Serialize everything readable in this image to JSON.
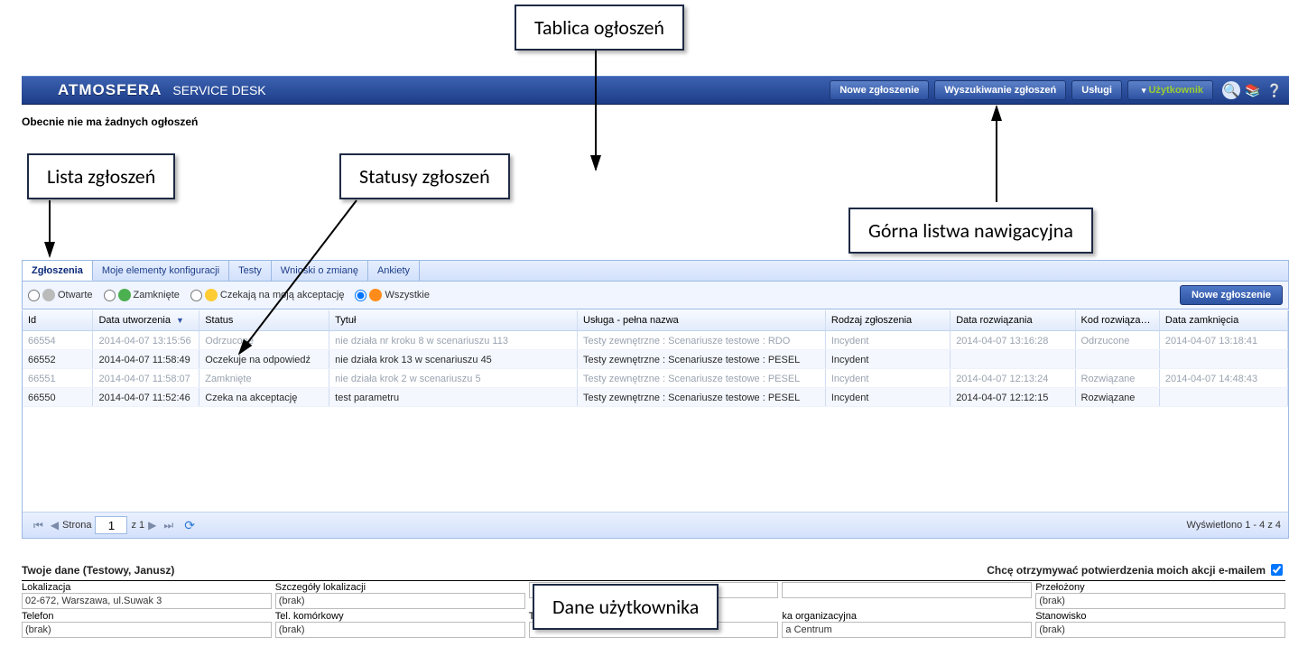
{
  "callouts": {
    "announcements": "Tablica ogłoszeń",
    "ticket_list": "Lista zgłoszeń",
    "statuses": "Statusy zgłoszeń",
    "top_nav": "Górna listwa nawigacyjna",
    "user_data": "Dane użytkownika"
  },
  "topbar": {
    "logo": "ATMOSFERA",
    "app": "SERVICE DESK",
    "buttons": {
      "new": "Nowe zgłoszenie",
      "search": "Wyszukiwanie zgłoszeń",
      "services": "Usługi",
      "user": "Użytkownik"
    }
  },
  "announce": "Obecnie nie ma żadnych ogłoszeń",
  "tabs": [
    "Zgłoszenia",
    "Moje elementy konfiguracji",
    "Testy",
    "Wnioski o zmianę",
    "Ankiety"
  ],
  "filters": {
    "open": "Otwarte",
    "closed": "Zamknięte",
    "awaiting": "Czekają na moją akceptację",
    "all": "Wszystkie",
    "primary": "Nowe zgłoszenie"
  },
  "columns": {
    "id": "Id",
    "created": "Data utworzenia",
    "status": "Status",
    "title": "Tytuł",
    "service": "Usługa - pełna nazwa",
    "kind": "Rodzaj zgłoszenia",
    "resolved": "Data rozwiązania",
    "rescode": "Kod rozwiązania",
    "closed": "Data zamknięcia"
  },
  "rows": [
    {
      "faded": true,
      "id": "66554",
      "created": "2014-04-07 13:15:56",
      "status": "Odrzucone",
      "title": "nie działa nr kroku 8 w scenariuszu 113",
      "service": "Testy zewnętrzne : Scenariusze testowe : RDO",
      "kind": "Incydent",
      "resolved": "2014-04-07 13:16:28",
      "rescode": "Odrzucone",
      "closed": "2014-04-07 13:18:41"
    },
    {
      "faded": false,
      "id": "66552",
      "created": "2014-04-07 11:58:49",
      "status": "Oczekuje na odpowiedź",
      "title": "nie działa krok 13 w scenariuszu 45",
      "service": "Testy zewnętrzne : Scenariusze testowe : PESEL",
      "kind": "Incydent",
      "resolved": "",
      "rescode": "",
      "closed": ""
    },
    {
      "faded": true,
      "id": "66551",
      "created": "2014-04-07 11:58:07",
      "status": "Zamknięte",
      "title": "nie działa krok 2 w scenariuszu 5",
      "service": "Testy zewnętrzne : Scenariusze testowe : PESEL",
      "kind": "Incydent",
      "resolved": "2014-04-07 12:13:24",
      "rescode": "Rozwiązane",
      "closed": "2014-04-07 14:48:43"
    },
    {
      "faded": false,
      "id": "66550",
      "created": "2014-04-07 11:52:46",
      "status": "Czeka na akceptację",
      "title": "test parametru",
      "service": "Testy zewnętrzne : Scenariusze testowe : PESEL",
      "kind": "Incydent",
      "resolved": "2014-04-07 12:12:15",
      "rescode": "Rozwiązane",
      "closed": ""
    }
  ],
  "pager": {
    "page_label": "Strona",
    "page": "1",
    "of": "z 1",
    "summary": "Wyświetlono 1 - 4 z 4"
  },
  "userpanel": {
    "title": "Twoje dane (Testowy, Janusz)",
    "opt_label": "Chcę otrzymywać potwierdzenia moich akcji e-mailem",
    "fields": {
      "loc_label": "Lokalizacja",
      "loc_val": "02-672, Warszawa, ul.Suwak 3",
      "locdet_label": "Szczegóły lokalizacji",
      "locdet_val": "(brak)",
      "col3a_label": "",
      "col3a_val": "",
      "col4a_label": "",
      "col4a_val": "",
      "sup_label": "Przełożony",
      "sup_val": "(brak)",
      "tel_label": "Telefon",
      "tel_val": "(brak)",
      "mob_label": "Tel. komórkowy",
      "mob_val": "(brak)",
      "col3b_label": "T",
      "col3b_val": "",
      "org_label": "ka organizacyjna",
      "org_val": "a Centrum",
      "pos_label": "Stanowisko",
      "pos_val": "(brak)"
    }
  }
}
